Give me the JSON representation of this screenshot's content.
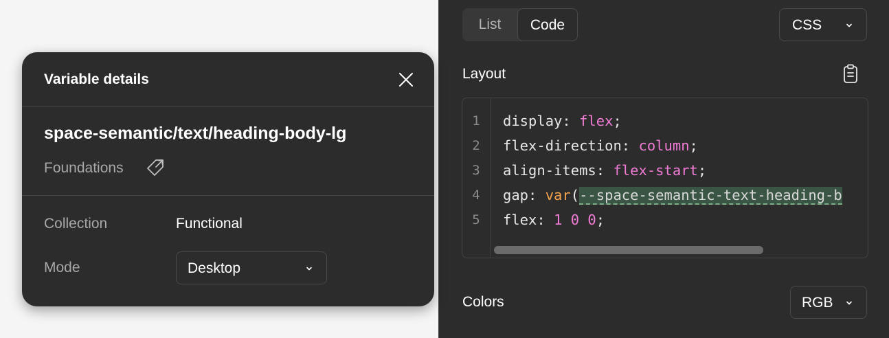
{
  "inspect_panel": {
    "view_tabs": [
      {
        "label": "List",
        "selected": false
      },
      {
        "label": "Code",
        "selected": true
      }
    ],
    "language_dropdown": {
      "value": "CSS",
      "icon": "chevron-down-icon"
    },
    "layout_section": {
      "label": "Layout",
      "copy_icon": "clipboard-icon",
      "code_lines": [
        {
          "num": "1",
          "prop": "display: ",
          "value": "flex",
          "end": ";"
        },
        {
          "num": "2",
          "prop": "flex-direction: ",
          "value": "column",
          "end": ";"
        },
        {
          "num": "3",
          "prop": "align-items: ",
          "value": "flex-start",
          "end": ";"
        },
        {
          "num": "4",
          "prop": "gap: ",
          "func": "var",
          "open": "(",
          "variable": "--space-semantic-text-heading-b"
        },
        {
          "num": "5",
          "prop": "flex: ",
          "value": "1 0 0",
          "end": ";"
        }
      ]
    },
    "colors_section": {
      "label": "Colors",
      "format_dropdown": {
        "value": "RGB",
        "icon": "chevron-down-icon"
      }
    }
  },
  "variable_details": {
    "title": "Variable details",
    "close_icon": "close-icon",
    "name": "space-semantic/text/heading-body-lg",
    "group": "Foundations",
    "group_icon": "tag-link-icon",
    "collection_label": "Collection",
    "collection_value": "Functional",
    "mode_label": "Mode",
    "mode_value": "Desktop"
  },
  "colors": {
    "panel_bg": "#2c2c2c",
    "page_bg": "#f5f5f5",
    "keyword": "#f07bd4",
    "function": "#f5a34b",
    "variable_highlight": "#3b5544"
  }
}
